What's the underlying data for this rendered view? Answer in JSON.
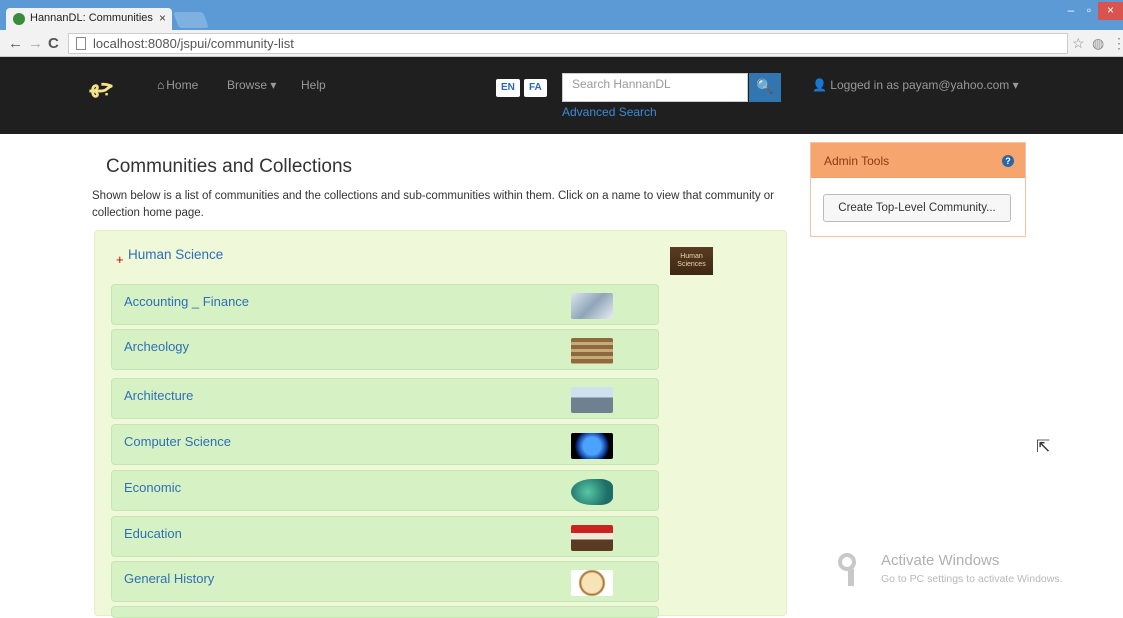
{
  "browser": {
    "tab_title": "HannanDL: Communities",
    "tab_close": "×",
    "url": "localhost:8080/jspui/community-list",
    "controls": {
      "minimize": "–",
      "maximize": "▫",
      "close": "×"
    },
    "nav": {
      "back": "←",
      "forward": "→",
      "reload": "C"
    },
    "icons": {
      "star": "☆",
      "globe": "◍",
      "menu": "⋮"
    }
  },
  "navbar": {
    "logo": "ج‍ه‍",
    "home_label": "Home",
    "browse_label": "Browse ▾",
    "help_label": "Help",
    "lang_en": "EN",
    "lang_fa": "FA",
    "search_placeholder": "Search HannanDL",
    "search_icon": "🔍",
    "advanced_search": "Advanced Search",
    "logged_in": "Logged in as payam@yahoo.com ▾"
  },
  "main": {
    "title": "Communities and Collections",
    "intro": "Shown below is a list of communities and the collections and sub-communities within them. Click on a name to view that community or collection home page.",
    "community": {
      "expand": "+",
      "name": "Human Science",
      "logo_text": "Human Sciences"
    },
    "collections": [
      {
        "name": "Accounting _ Finance"
      },
      {
        "name": "Archeology"
      },
      {
        "name": "Architecture"
      },
      {
        "name": "Computer Science"
      },
      {
        "name": "Economic"
      },
      {
        "name": "Education"
      },
      {
        "name": "General History"
      }
    ]
  },
  "admin": {
    "title": "Admin Tools",
    "help": "?",
    "create_button": "Create Top-Level Community..."
  },
  "watermark": {
    "title": "Activate Windows",
    "subtitle": "Go to PC settings to activate Windows."
  },
  "colors": {
    "navbar": "#1f1f1f",
    "title_bar": "#5b9ad5",
    "community_panel": "#f0f8da",
    "collection_row": "#d6f2c4",
    "link": "#2f6fb5",
    "admin_header": "#f7a56e",
    "search_button": "#3276b1"
  }
}
